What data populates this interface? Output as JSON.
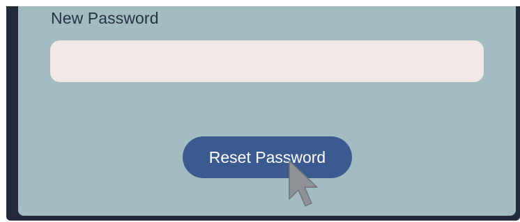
{
  "form": {
    "new_password_label": "New Password",
    "new_password_value": "",
    "reset_button_label": "Reset Password"
  },
  "icons": {
    "cursor": "mouse-pointer-icon"
  },
  "colors": {
    "page_background": "#232a3b",
    "card_background": "#a3bcc1",
    "input_background": "#f1e9e6",
    "button_background": "#3a5a90",
    "button_text": "#ffffff",
    "label_text": "#273245"
  }
}
